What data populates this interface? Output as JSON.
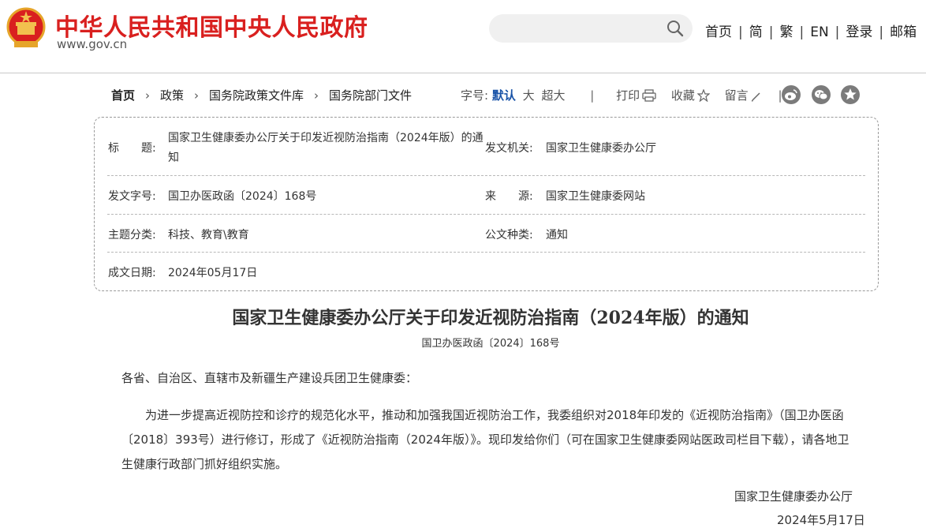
{
  "header": {
    "site_title": "中华人民共和国中央人民政府",
    "site_url": "www.gov.cn",
    "search_placeholder": "",
    "nav": [
      "首页",
      "简",
      "繁",
      "EN",
      "登录",
      "邮箱"
    ],
    "brand_color": "#d9201f"
  },
  "breadcrumb": [
    "首页",
    "政策",
    "国务院政策文件库",
    "国务院部门文件"
  ],
  "toolbar": {
    "font_size_label": "字号:",
    "font_sizes": [
      "默认",
      "大",
      "超大"
    ],
    "print_label": "打印",
    "favorite_label": "收藏",
    "comment_label": "留言",
    "share_icons": [
      "weibo-icon",
      "wechat-icon",
      "star-share-icon"
    ]
  },
  "info": {
    "title_label": "标　　题:",
    "title_value_line1": "国家卫生健康委办公厅关于印发近视防治指南（2024年版）的通",
    "title_value_line2": "知",
    "issuer_label": "发文机关:",
    "issuer_value": "国家卫生健康委办公厅",
    "docno_label": "发文字号:",
    "docno_value": "国卫办医政函〔2024〕168号",
    "source_label": "来　　源:",
    "source_value": "国家卫生健康委网站",
    "topic_label": "主题分类:",
    "topic_value": "科技、教育\\教育",
    "type_label": "公文种类:",
    "type_value": "通知",
    "date_label": "成文日期:",
    "date_value": "2024年05月17日"
  },
  "article": {
    "title": "国家卫生健康委办公厅关于印发近视防治指南（2024年版）的通知",
    "docno": "国卫办医政函〔2024〕168号",
    "salutation": "各省、自治区、直辖市及新疆生产建设兵团卫生健康委：",
    "paragraph": "为进一步提高近视防控和诊疗的规范化水平，推动和加强我国近视防治工作，我委组织对2018年印发的《近视防治指南》（国卫办医函〔2018〕393号）进行修订，形成了《近视防治指南（2024年版）》。现印发给你们（可在国家卫生健康委网站医政司栏目下载），请各地卫生健康行政部门抓好组织实施。",
    "signature": "国家卫生健康委办公厅",
    "sign_date": "2024年5月17日"
  }
}
